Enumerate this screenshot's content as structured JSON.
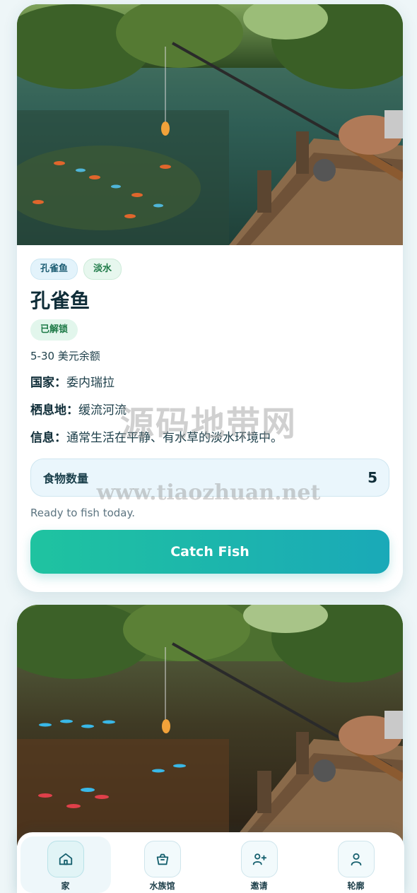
{
  "card": {
    "tags": [
      "孔雀鱼",
      "淡水"
    ],
    "title": "孔雀鱼",
    "status": "已解锁",
    "range": "5-30 美元余额",
    "country_label": "国家：",
    "country_value": "委内瑞拉",
    "habitat_label": "栖息地：",
    "habitat_value": "缓流河流",
    "info_label": "信息：",
    "info_value": "通常生活在平静、有水草的淡水环境中。",
    "food_label": "食物数量",
    "food_value": "5",
    "ready_text": "Ready to fish today.",
    "catch_button": "Catch Fish"
  },
  "watermark": {
    "line1": "源码地带网",
    "line2": "www.tiaozhuan.net"
  },
  "nav": {
    "items": [
      {
        "label": "家",
        "icon": "home-icon",
        "active": true
      },
      {
        "label": "水族馆",
        "icon": "aquarium-icon",
        "active": false
      },
      {
        "label": "邀请",
        "icon": "invite-icon",
        "active": false
      },
      {
        "label": "轮廓",
        "icon": "profile-icon",
        "active": false
      }
    ]
  },
  "colors": {
    "accent_start": "#1fc3a0",
    "accent_end": "#1aa9b8",
    "tag_blue": "#e3f3fb",
    "tag_green": "#e7f7ee"
  }
}
